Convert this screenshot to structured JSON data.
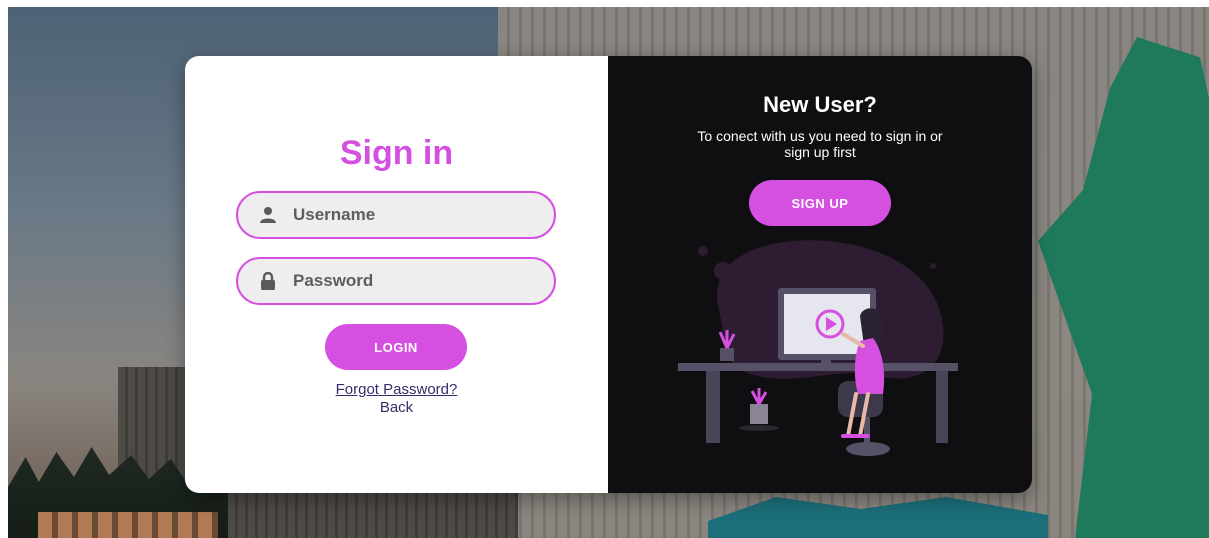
{
  "signin": {
    "title": "Sign in",
    "username_placeholder": "Username",
    "password_placeholder": "Password",
    "login_label": "LOGIN",
    "forgot_label": "Forgot Password?",
    "back_label": "Back"
  },
  "signup": {
    "title": "New User?",
    "description": "To conect with us you need to sign in or sign up first",
    "button_label": "SIGN UP"
  },
  "icons": {
    "username": "user-icon",
    "password": "lock-icon"
  },
  "colors": {
    "accent": "#d54fe0",
    "dark_panel": "#0f0e10",
    "link": "#3b2a6a"
  }
}
